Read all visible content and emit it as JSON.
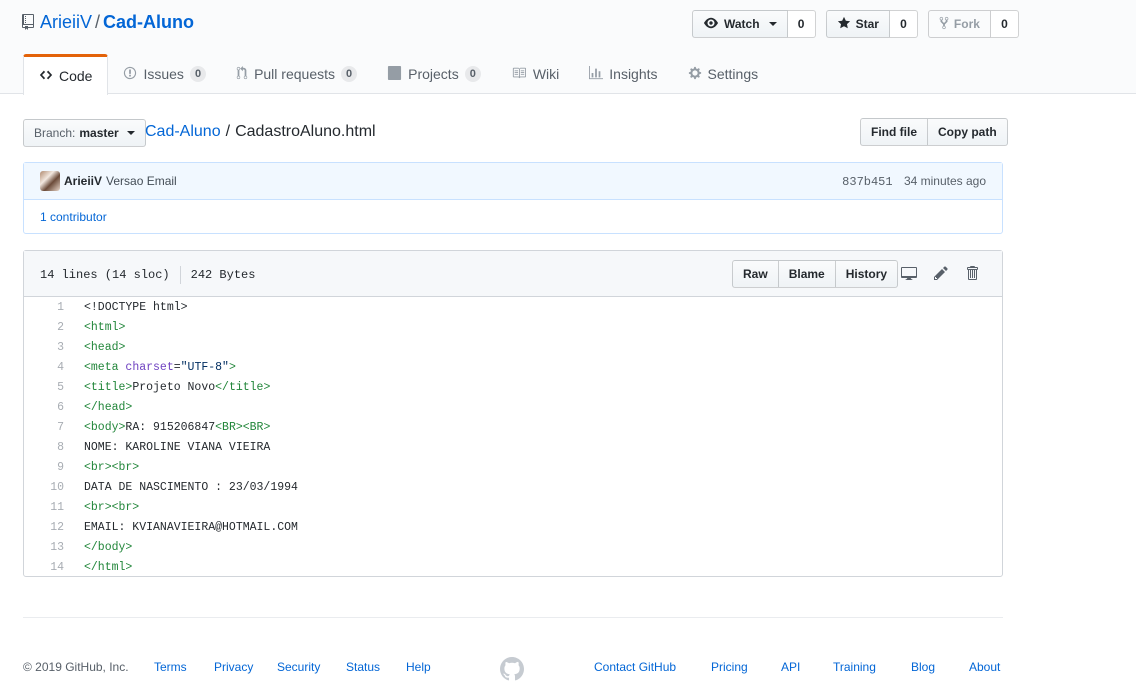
{
  "repo": {
    "owner": "ArieiiV",
    "separator": "/",
    "name": "Cad-Aluno"
  },
  "header_actions": {
    "watch": {
      "label": "Watch",
      "count": "0"
    },
    "star": {
      "label": "Star",
      "count": "0"
    },
    "fork": {
      "label": "Fork",
      "count": "0"
    }
  },
  "tabs": [
    {
      "label": "Code",
      "icon": "code-icon"
    },
    {
      "label": "Issues",
      "count": "0",
      "icon": "issue-icon"
    },
    {
      "label": "Pull requests",
      "count": "0",
      "icon": "pull-request-icon"
    },
    {
      "label": "Projects",
      "count": "0",
      "icon": "project-icon"
    },
    {
      "label": "Wiki",
      "icon": "book-icon"
    },
    {
      "label": "Insights",
      "icon": "graph-icon"
    },
    {
      "label": "Settings",
      "icon": "gear-icon"
    }
  ],
  "branch": {
    "label": "Branch:",
    "value": "master"
  },
  "breadcrumb": {
    "root": "Cad-Aluno",
    "separator": "/",
    "file": "CadastroAluno.html"
  },
  "file_nav": {
    "find_file": "Find file",
    "copy_path": "Copy path"
  },
  "commit": {
    "author": "ArieiiV",
    "message": "Versao Email",
    "sha": "837b451",
    "time": "34 minutes ago",
    "contributors": "1 contributor"
  },
  "file": {
    "lines_info": "14 lines (14 sloc)",
    "size": "242 Bytes",
    "buttons": {
      "raw": "Raw",
      "blame": "Blame",
      "history": "History"
    }
  },
  "code_lines": [
    [
      [
        "p",
        "<!DOCTYPE html>"
      ]
    ],
    [
      [
        "t",
        "<html>"
      ]
    ],
    [
      [
        "t",
        "<head>"
      ]
    ],
    [
      [
        "t",
        "<meta "
      ],
      [
        "a",
        "charset"
      ],
      [
        "p",
        "="
      ],
      [
        "s",
        "\"UTF-8\""
      ],
      [
        "t",
        ">"
      ]
    ],
    [
      [
        "t",
        "<title>"
      ],
      [
        "p",
        "Projeto Novo"
      ],
      [
        "t",
        "</title>"
      ]
    ],
    [
      [
        "t",
        "</head>"
      ]
    ],
    [
      [
        "t",
        "<body>"
      ],
      [
        "p",
        "RA: 915206847"
      ],
      [
        "t",
        "<BR><BR>"
      ]
    ],
    [
      [
        "p",
        "NOME: KAROLINE VIANA VIEIRA"
      ]
    ],
    [
      [
        "t",
        "<br><br>"
      ]
    ],
    [
      [
        "p",
        "DATA DE NASCIMENTO : 23/03/1994"
      ]
    ],
    [
      [
        "t",
        "<br><br>"
      ]
    ],
    [
      [
        "p",
        "EMAIL: KVIANAVIEIRA@HOTMAIL.COM"
      ]
    ],
    [
      [
        "t",
        "</body>"
      ]
    ],
    [
      [
        "t",
        "</html>"
      ]
    ]
  ],
  "footer": {
    "copyright": "© 2019 GitHub, Inc.",
    "links_left": [
      "Terms",
      "Privacy",
      "Security",
      "Status",
      "Help"
    ],
    "links_right": [
      "Contact GitHub",
      "Pricing",
      "API",
      "Training",
      "Blog",
      "About"
    ]
  }
}
